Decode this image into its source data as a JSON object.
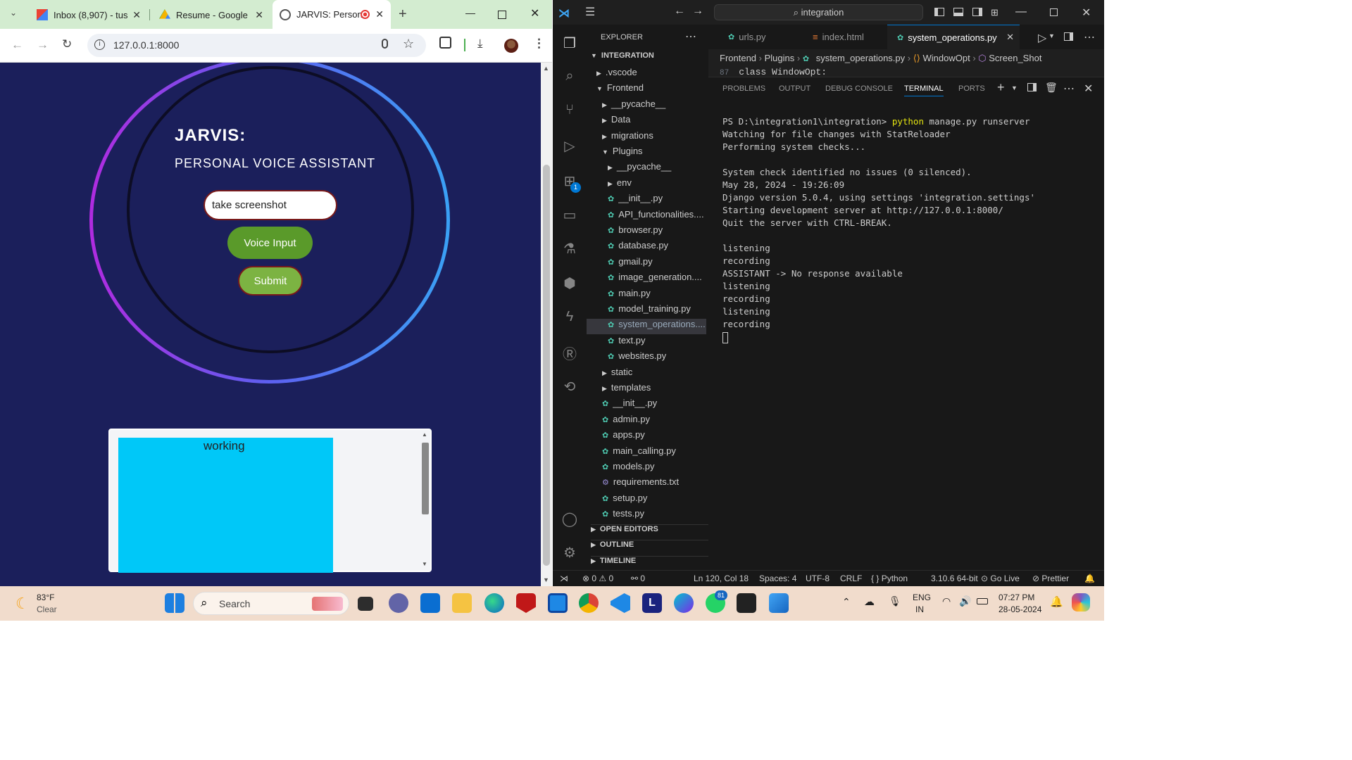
{
  "browser": {
    "tabs": [
      {
        "title": "Inbox (8,907) - tus"
      },
      {
        "title": "Resume - Google"
      },
      {
        "title": "JARVIS: Person"
      }
    ],
    "url": "127.0.0.1:8000"
  },
  "app": {
    "title": "JARVIS:",
    "subtitle": "PERSONAL VOICE ASSISTANT",
    "command_value": "take screenshot",
    "voice_label": "Voice Input",
    "submit_label": "Submit",
    "output_text": "working"
  },
  "vscode": {
    "search": "integration",
    "explorer_title": "EXPLORER",
    "workspace": "INTEGRATION",
    "tree": [
      {
        "label": ".vscode",
        "type": "folder-closed",
        "depth": 1
      },
      {
        "label": "Frontend",
        "type": "folder-open",
        "depth": 1
      },
      {
        "label": "__pycache__",
        "type": "folder-closed",
        "depth": 2
      },
      {
        "label": "Data",
        "type": "folder-closed",
        "depth": 2
      },
      {
        "label": "migrations",
        "type": "folder-closed",
        "depth": 2
      },
      {
        "label": "Plugins",
        "type": "folder-open",
        "depth": 2
      },
      {
        "label": "__pycache__",
        "type": "folder-closed",
        "depth": 3
      },
      {
        "label": "env",
        "type": "folder-closed",
        "depth": 3
      },
      {
        "label": "__init__.py",
        "type": "py",
        "depth": 3
      },
      {
        "label": "API_functionalities....",
        "type": "py",
        "depth": 3
      },
      {
        "label": "browser.py",
        "type": "py",
        "depth": 3
      },
      {
        "label": "database.py",
        "type": "py",
        "depth": 3
      },
      {
        "label": "gmail.py",
        "type": "py",
        "depth": 3
      },
      {
        "label": "image_generation....",
        "type": "py",
        "depth": 3
      },
      {
        "label": "main.py",
        "type": "py",
        "depth": 3
      },
      {
        "label": "model_training.py",
        "type": "py",
        "depth": 3
      },
      {
        "label": "system_operations....",
        "type": "py",
        "depth": 3,
        "selected": true
      },
      {
        "label": "text.py",
        "type": "py",
        "depth": 3
      },
      {
        "label": "websites.py",
        "type": "py",
        "depth": 3
      },
      {
        "label": "static",
        "type": "folder-closed",
        "depth": 2
      },
      {
        "label": "templates",
        "type": "folder-closed",
        "depth": 2
      },
      {
        "label": "__init__.py",
        "type": "py",
        "depth": 2
      },
      {
        "label": "admin.py",
        "type": "py",
        "depth": 2
      },
      {
        "label": "apps.py",
        "type": "py",
        "depth": 2
      },
      {
        "label": "main_calling.py",
        "type": "py",
        "depth": 2
      },
      {
        "label": "models.py",
        "type": "py",
        "depth": 2
      },
      {
        "label": "requirements.txt",
        "type": "txt",
        "depth": 2
      },
      {
        "label": "setup.py",
        "type": "py",
        "depth": 2
      },
      {
        "label": "tests.py",
        "type": "py",
        "depth": 2
      }
    ],
    "sections": [
      "OPEN EDITORS",
      "OUTLINE",
      "TIMELINE"
    ],
    "editor_tabs": [
      "urls.py",
      "index.html",
      "system_operations.py"
    ],
    "breadcrumb": [
      "Frontend",
      "Plugins",
      "system_operations.py",
      "WindowOpt",
      "Screen_Shot"
    ],
    "code_line_no": "87",
    "code_line": "class WindowOpt:",
    "panel_tabs": [
      "PROBLEMS",
      "OUTPUT",
      "DEBUG CONSOLE",
      "TERMINAL",
      "PORTS"
    ],
    "terminal_prompt": "PS D:\\integration1\\integration> ",
    "terminal_cmd": "python",
    "terminal_args": " manage.py runserver",
    "terminal_lines": [
      "Watching for file changes with StatReloader",
      "Performing system checks...",
      "",
      "System check identified no issues (0 silenced).",
      "May 28, 2024 - 19:26:09",
      "Django version 5.0.4, using settings 'integration.settings'",
      "Starting development server at http://127.0.0.1:8000/",
      "Quit the server with CTRL-BREAK.",
      "",
      "listening",
      "recording",
      "ASSISTANT -> No response available",
      "listening",
      "recording",
      "listening",
      "recording"
    ],
    "status": {
      "errors": "0",
      "warnings": "0",
      "ports": "0",
      "position": "Ln 120, Col 18",
      "spaces": "Spaces: 4",
      "encoding": "UTF-8",
      "eol": "CRLF",
      "language": "Python",
      "interpreter": "3.10.6 64-bit",
      "golive": "Go Live",
      "prettier": "Prettier"
    },
    "badge": "1"
  },
  "taskbar": {
    "temp": "83°F",
    "weather": "Clear",
    "search": "Search",
    "lang1": "ENG",
    "lang2": "IN",
    "time": "07:27 PM",
    "date": "28-05-2024",
    "whatsapp_badge": "81"
  },
  "colors": {
    "page_bg": "#1b1f5b",
    "output_fill": "#00c8f8",
    "voice_btn": "#5a9a2a",
    "submit_btn": "#7cb342"
  }
}
